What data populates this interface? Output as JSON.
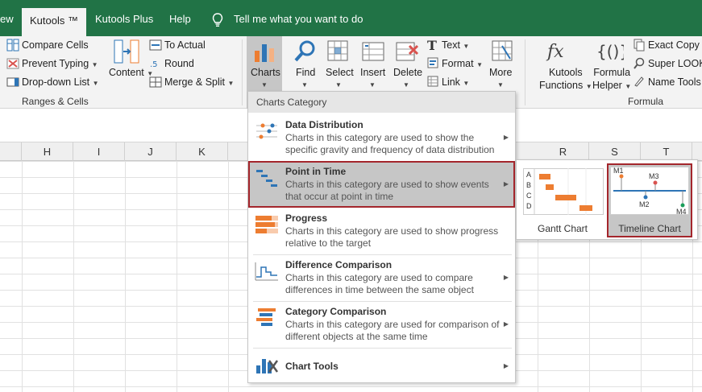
{
  "tabs": [
    {
      "label": "ew"
    },
    {
      "label": "Kutools ™"
    },
    {
      "label": "Kutools Plus"
    },
    {
      "label": "Help"
    }
  ],
  "tell_me": "Tell me what you want to do",
  "ribbon": {
    "ranges_cells": {
      "compare_cells": "Compare Cells",
      "prevent_typing": "Prevent Typing",
      "dropdown_list": "Drop-down List",
      "group_label": "Ranges & Cells"
    },
    "content": "Content",
    "to_actual": "To Actual",
    "round": "Round",
    "merge_split": "Merge & Split",
    "charts": "Charts",
    "find": "Find",
    "select": "Select",
    "insert": "Insert",
    "delete": "Delete",
    "text": "Text",
    "format": "Format",
    "link": "Link",
    "more": "More",
    "kutools_functions": [
      "Kutools",
      "Functions"
    ],
    "formula_helper": [
      "Formula",
      "Helper"
    ],
    "exact_copy": "Exact Copy",
    "super_lookup": "Super LOOKU",
    "name_tools": "Name Tools",
    "formula_group": "Formula"
  },
  "columns_left": [
    "H",
    "I",
    "J",
    "K"
  ],
  "columns_right": [
    "R",
    "S",
    "T"
  ],
  "menu": {
    "header": "Charts Category",
    "items": [
      {
        "title": "Data Distribution",
        "desc": "Charts in this category are used to show the specific gravity and frequency of data distribution"
      },
      {
        "title": "Point in Time",
        "desc": "Charts in this category are used to show events that occur at point in time"
      },
      {
        "title": "Progress",
        "desc": "Charts in this category are used to show progress relative to the target"
      },
      {
        "title": "Difference Comparison",
        "desc": "Charts in this category are used to compare differences in time between the same object"
      },
      {
        "title": "Category Comparison",
        "desc": "Charts in this category are used for comparison of different objects at the same time"
      }
    ],
    "chart_tools": "Chart Tools"
  },
  "submenu": {
    "gantt": {
      "label": "Gantt Chart",
      "rows": [
        "A",
        "B",
        "C",
        "D"
      ]
    },
    "timeline": {
      "label": "Timeline Chart",
      "markers": [
        "M1",
        "M2",
        "M3",
        "M4"
      ]
    }
  },
  "colors": {
    "excel_green": "#217346",
    "select_border": "#a4262c",
    "orange": "#ed7d31",
    "blue": "#2e75b6"
  }
}
